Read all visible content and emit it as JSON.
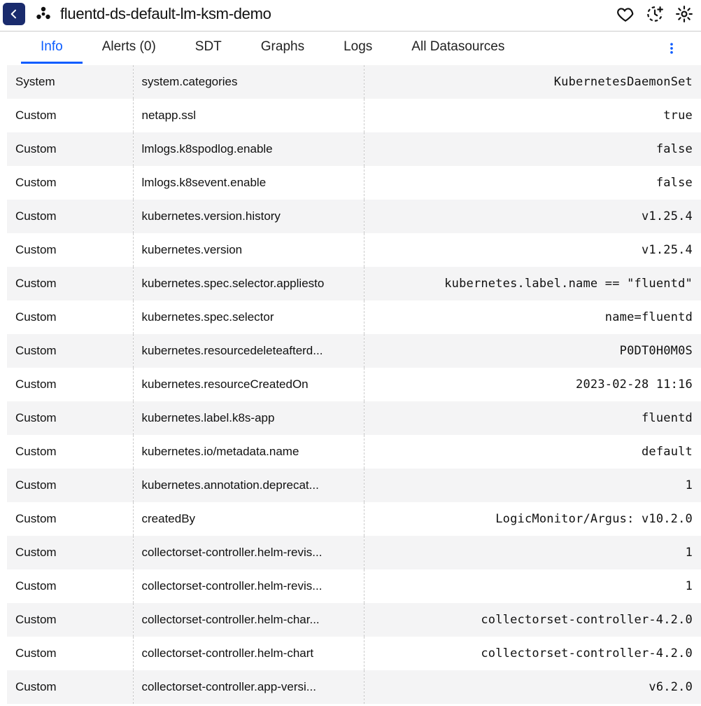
{
  "header": {
    "title": "fluentd-ds-default-lm-ksm-demo"
  },
  "tabs": [
    {
      "label": "Info",
      "active": true
    },
    {
      "label": "Alerts (0)",
      "active": false
    },
    {
      "label": "SDT",
      "active": false
    },
    {
      "label": "Graphs",
      "active": false
    },
    {
      "label": "Logs",
      "active": false
    },
    {
      "label": "All Datasources",
      "active": false
    }
  ],
  "rows": [
    {
      "type": "System",
      "key": "system.categories",
      "value": "KubernetesDaemonSet"
    },
    {
      "type": "Custom",
      "key": "netapp.ssl",
      "value": "true"
    },
    {
      "type": "Custom",
      "key": "lmlogs.k8spodlog.enable",
      "value": "false"
    },
    {
      "type": "Custom",
      "key": "lmlogs.k8sevent.enable",
      "value": "false"
    },
    {
      "type": "Custom",
      "key": "kubernetes.version.history",
      "value": "v1.25.4"
    },
    {
      "type": "Custom",
      "key": "kubernetes.version",
      "value": "v1.25.4"
    },
    {
      "type": "Custom",
      "key": "kubernetes.spec.selector.appliesto",
      "value": "kubernetes.label.name == \"fluentd\""
    },
    {
      "type": "Custom",
      "key": "kubernetes.spec.selector",
      "value": "name=fluentd"
    },
    {
      "type": "Custom",
      "key": "kubernetes.resourcedeleteafterd...",
      "value": "P0DT0H0M0S"
    },
    {
      "type": "Custom",
      "key": "kubernetes.resourceCreatedOn",
      "value": "2023-02-28 11:16"
    },
    {
      "type": "Custom",
      "key": "kubernetes.label.k8s-app",
      "value": "fluentd"
    },
    {
      "type": "Custom",
      "key": "kubernetes.io/metadata.name",
      "value": "default"
    },
    {
      "type": "Custom",
      "key": "kubernetes.annotation.deprecat...",
      "value": "1"
    },
    {
      "type": "Custom",
      "key": "createdBy",
      "value": "LogicMonitor/Argus: v10.2.0"
    },
    {
      "type": "Custom",
      "key": "collectorset-controller.helm-revis...",
      "value": "1"
    },
    {
      "type": "Custom",
      "key": "collectorset-controller.helm-revis...",
      "value": "1"
    },
    {
      "type": "Custom",
      "key": "collectorset-controller.helm-char...",
      "value": "collectorset-controller-4.2.0"
    },
    {
      "type": "Custom",
      "key": "collectorset-controller.helm-chart",
      "value": "collectorset-controller-4.2.0"
    },
    {
      "type": "Custom",
      "key": "collectorset-controller.app-versi...",
      "value": "v6.2.0"
    }
  ]
}
